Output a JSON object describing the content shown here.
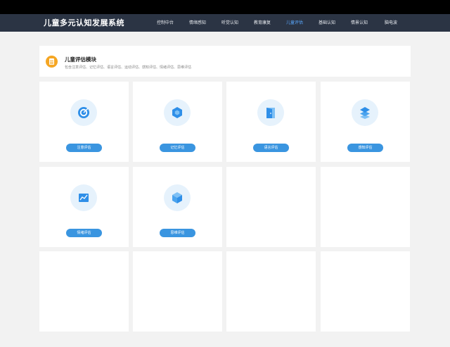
{
  "app": {
    "title": "儿童多元认知发展系统"
  },
  "nav": {
    "items": [
      {
        "label": "控制中台"
      },
      {
        "label": "情绪感知"
      },
      {
        "label": "听觉认知"
      },
      {
        "label": "教育康复"
      },
      {
        "label": "儿童评估",
        "active": true
      },
      {
        "label": "基础认知"
      },
      {
        "label": "情景认知"
      },
      {
        "label": "脑电波"
      }
    ],
    "active_color": "#5aa9ff"
  },
  "header": {
    "title": "儿童评估模块",
    "description": "包含注意评估、记忆评估、语言评估、运动评估、感知评估、情绪评估、思维评估",
    "icon": "clipboard-icon"
  },
  "modules": [
    {
      "label": "注意评估",
      "icon": "target-icon"
    },
    {
      "label": "记忆评估",
      "icon": "hexagon-icon"
    },
    {
      "label": "语言评估",
      "icon": "door-icon"
    },
    {
      "label": "感知评估",
      "icon": "layers-icon"
    },
    {
      "label": "情绪评估",
      "icon": "line-chart-icon"
    },
    {
      "label": "思维评估",
      "icon": "cube-icon"
    }
  ],
  "colors": {
    "navbar": "#2b3444",
    "accent": "#3a95e0",
    "header_icon": "#f5a623"
  }
}
